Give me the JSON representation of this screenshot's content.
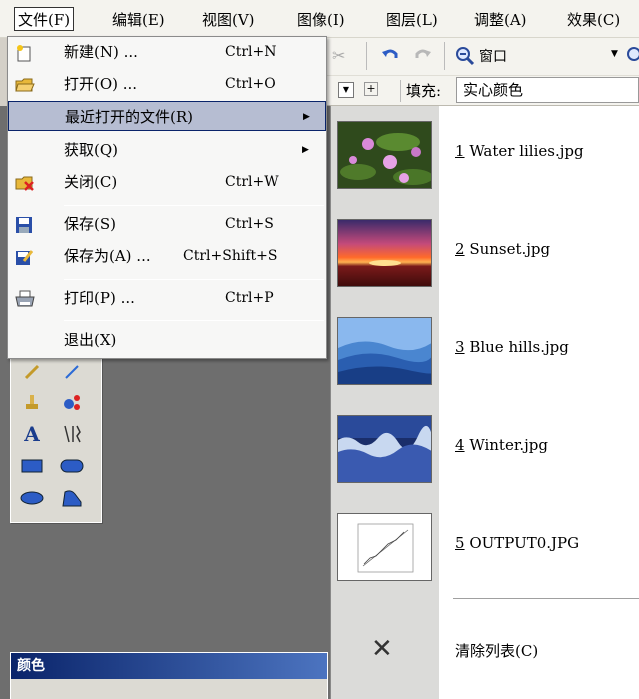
{
  "menubar": {
    "items": [
      {
        "label": "文件(F)"
      },
      {
        "label": "编辑(E)"
      },
      {
        "label": "视图(V)"
      },
      {
        "label": "图像(I)"
      },
      {
        "label": "图层(L)"
      },
      {
        "label": "调整(A)"
      },
      {
        "label": "效果(C)"
      }
    ]
  },
  "toolbar": {
    "zoom_value": "窗口",
    "fill_label": "填充:",
    "fill_value": "实心颜色"
  },
  "file_menu": {
    "items": [
      {
        "label": "新建(N) ...",
        "shortcut": "Ctrl+N",
        "icon": "new-file-icon"
      },
      {
        "label": "打开(O) ...",
        "shortcut": "Ctrl+O",
        "icon": "open-folder-icon"
      },
      {
        "label": "最近打开的文件(R)",
        "shortcut": "",
        "submenu": true
      },
      {
        "label": "获取(Q)",
        "shortcut": "",
        "submenu": true
      },
      {
        "label": "关闭(C)",
        "shortcut": "Ctrl+W",
        "icon": "close-file-icon"
      },
      {
        "label": "保存(S)",
        "shortcut": "Ctrl+S",
        "icon": "save-icon"
      },
      {
        "label": "保存为(A) ...",
        "shortcut": "Ctrl+Shift+S",
        "icon": "save-as-icon"
      },
      {
        "label": "打印(P) ...",
        "shortcut": "Ctrl+P",
        "icon": "print-icon"
      },
      {
        "label": "退出(X)",
        "shortcut": ""
      }
    ]
  },
  "recent_files": {
    "items": [
      {
        "num": "1",
        "name": " Water lilies.jpg"
      },
      {
        "num": "2",
        "name": " Sunset.jpg"
      },
      {
        "num": "3",
        "name": " Blue hills.jpg"
      },
      {
        "num": "4",
        "name": " Winter.jpg"
      },
      {
        "num": "5",
        "name": " OUTPUT0.JPG"
      }
    ],
    "clear_label": "清除列表(C)"
  },
  "colors_panel": {
    "title": "颜色"
  }
}
